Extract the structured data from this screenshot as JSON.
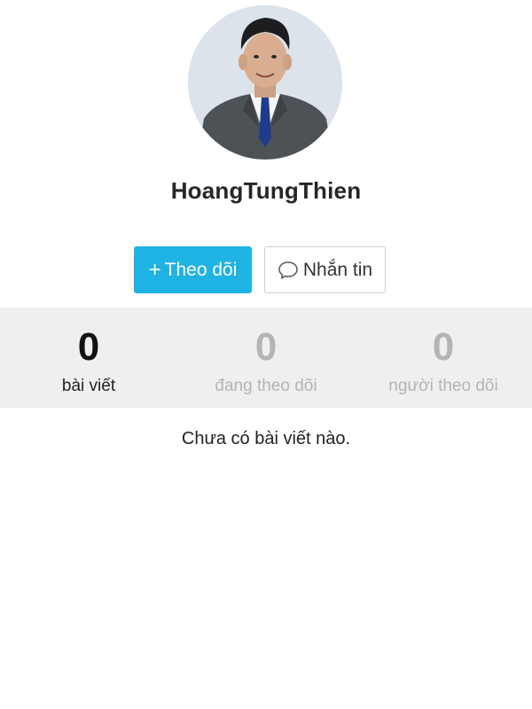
{
  "profile": {
    "username": "HoangTungThien",
    "avatar_alt": "profile photo"
  },
  "actions": {
    "follow_icon": "plus-icon",
    "follow_plus": "+",
    "follow_label": "Theo dõi",
    "message_icon": "chat-bubble-icon",
    "message_label": "Nhắn tin",
    "follow_color": "#1fb3e3"
  },
  "stats": [
    {
      "count": "0",
      "label": "bài viết",
      "active": true
    },
    {
      "count": "0",
      "label": "đang theo dõi",
      "active": false
    },
    {
      "count": "0",
      "label": "người theo dõi",
      "active": false
    }
  ],
  "feed": {
    "empty_message": "Chưa có bài viết nào."
  }
}
